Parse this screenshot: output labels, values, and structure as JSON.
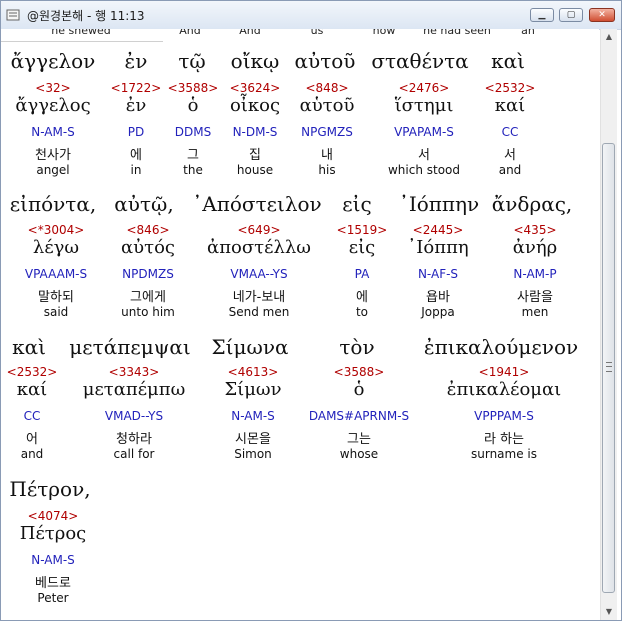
{
  "window": {
    "title": "@원경본해 - 행 11:13",
    "icon": "app-icon",
    "buttons": {
      "minimize": "minimize-icon",
      "maximize": "maximize-icon",
      "close": "close-icon"
    }
  },
  "top_partial_row": [
    "he shewed",
    "And",
    "And",
    "us",
    "how",
    "he had seen",
    "an"
  ],
  "lines": [
    {
      "words": [
        "ἄγγελον",
        "ἐν",
        "τῷ",
        "οἴκῳ",
        "αὐτοῦ",
        "σταθέντα",
        "καὶ"
      ],
      "columns": [
        {
          "strong": "<32>",
          "lemma": "ἄγγελος",
          "morph": "N-AM-S",
          "kor": "천사가",
          "eng": "angel"
        },
        {
          "strong": "<1722>",
          "lemma": "ἐν",
          "morph": "PD",
          "kor": "에",
          "eng": "in"
        },
        {
          "strong": "<3588>",
          "lemma": "ὁ",
          "morph": "DDMS",
          "kor": "그",
          "eng": "the"
        },
        {
          "strong": "<3624>",
          "lemma": "οἶκος",
          "morph": "N-DM-S",
          "kor": "집",
          "eng": "house"
        },
        {
          "strong": "<848>",
          "lemma": "αὑτοῦ",
          "morph": "NPGMZS",
          "kor": "내",
          "eng": "his"
        },
        {
          "strong": "<2476>",
          "lemma": "ἵστημι",
          "morph": "VPAPAM-S",
          "kor": "서",
          "eng": "which stood"
        },
        {
          "strong": "<2532>",
          "lemma": "καί",
          "morph": "CC",
          "kor": "서",
          "eng": "and"
        }
      ]
    },
    {
      "words": [
        "εἰπόντα,",
        "αὐτῷ,",
        "᾿Απόστειλον",
        "εἰς",
        "᾿Ιόππην",
        "ἄνδρας,"
      ],
      "columns": [
        {
          "strong": "<*3004>",
          "lemma": "λέγω",
          "morph": "VPAAAM-S",
          "kor": "말하되",
          "eng": "said"
        },
        {
          "strong": "<846>",
          "lemma": "αὐτός",
          "morph": "NPDMZS",
          "kor": "그에게",
          "eng": "unto him"
        },
        {
          "strong": "<649>",
          "lemma": "ἀποστέλλω",
          "morph": "VMAA--YS",
          "kor": "네가-보내",
          "eng": "Send men"
        },
        {
          "strong": "<1519>",
          "lemma": "εἰς",
          "morph": "PA",
          "kor": "에",
          "eng": "to"
        },
        {
          "strong": "<2445>",
          "lemma": "᾿Ιόππη",
          "morph": "N-AF-S",
          "kor": "욥바",
          "eng": "Joppa"
        },
        {
          "strong": "<435>",
          "lemma": "ἀνήρ",
          "morph": "N-AM-P",
          "kor": "사람을",
          "eng": "men"
        }
      ]
    },
    {
      "words": [
        "καὶ",
        "μετάπεμψαι",
        "Σίμωνα",
        "τὸν",
        "ἐπικαλούμενον"
      ],
      "columns": [
        {
          "strong": "<2532>",
          "lemma": "καί",
          "morph": "CC",
          "kor": "어",
          "eng": "and"
        },
        {
          "strong": "<3343>",
          "lemma": "μεταπέμπω",
          "morph": "VMAD--YS",
          "kor": "청하라",
          "eng": "call for"
        },
        {
          "strong": "<4613>",
          "lemma": "Σίμων",
          "morph": "N-AM-S",
          "kor": "시몬을",
          "eng": "Simon"
        },
        {
          "strong": "<3588>",
          "lemma": "ὁ",
          "morph": "DAMS#APRNM-S",
          "kor": "그는",
          "eng": "whose"
        },
        {
          "strong": "<1941>",
          "lemma": "ἐπικαλέομαι",
          "morph": "VPPPAM-S",
          "kor": "라 하는",
          "eng": "surname is"
        }
      ]
    },
    {
      "words": [
        "Πέτρον,"
      ],
      "columns": [
        {
          "strong": "<4074>",
          "lemma": "Πέτρος",
          "morph": "N-AM-S",
          "kor": "베드로",
          "eng": "Peter"
        }
      ]
    }
  ],
  "scrollbar": {
    "up": "scroll-up-arrow-icon",
    "down": "scroll-down-arrow-icon",
    "grip": "scroll-grip-icon"
  }
}
